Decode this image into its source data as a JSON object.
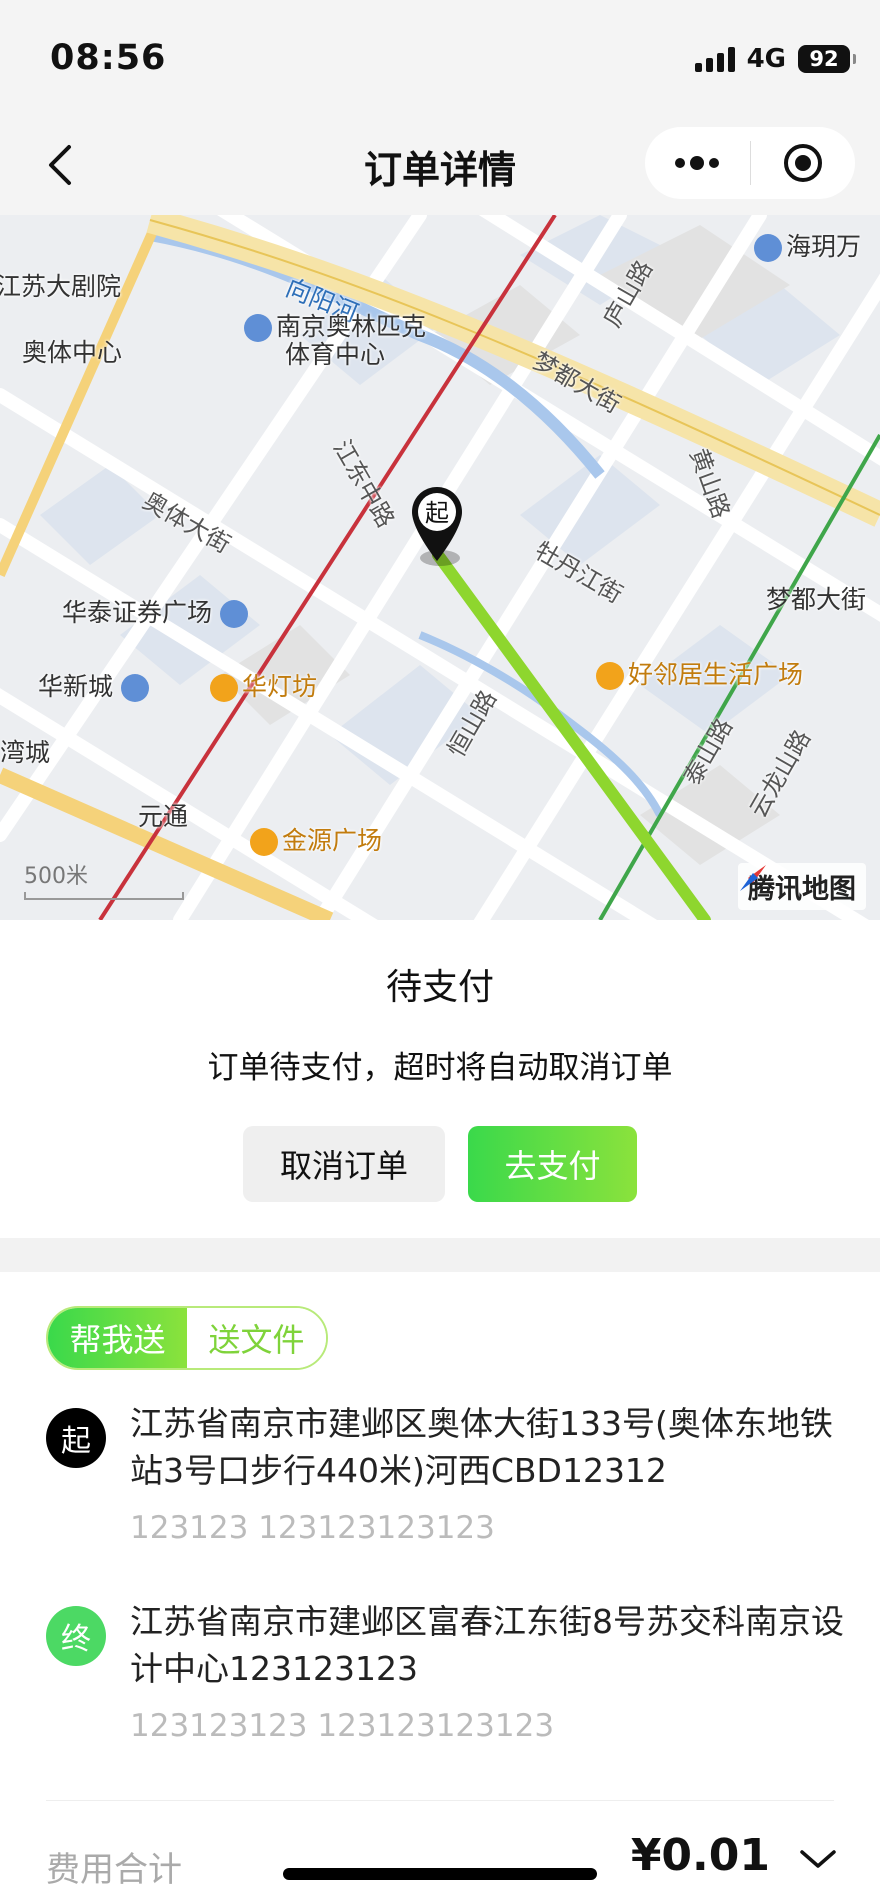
{
  "status_bar": {
    "time": "08:56",
    "network": "4G",
    "battery": "92"
  },
  "nav": {
    "title": "订单详情"
  },
  "map": {
    "labels": {
      "jiangsu_theater": "江苏大剧院",
      "xiangyang_river": "向阳河",
      "olympic_center": "奥体中心",
      "nanjing_olympic": "南京奥林匹克",
      "sports_center": "体育中心",
      "aoti_street": "奥体大街",
      "jiangdong_road": "江东中路",
      "mengdu_street": "梦都大街",
      "lushan_road": "庐山路",
      "huangshan_road": "黄山路",
      "mudanjiang_street": "牡丹江街",
      "huatai": "华泰证券广场",
      "huaxin_city": "华新城",
      "huadeng_fang": "华灯坊",
      "haolinju": "好邻居生活广场",
      "hengshan_road": "恒山路",
      "taishan_road": "泰山路",
      "yunlong_road": "云龙山路",
      "wan_cheng": "湾城",
      "yuantong": "元通",
      "jinyuan": "金源广场",
      "haiyue": "海玥万",
      "mengdu_right": "梦都大街",
      "scale": "500米",
      "logo": "腾讯地图",
      "pin": "起"
    }
  },
  "order_status": {
    "title": "待支付",
    "description": "订单待支付，超时将自动取消订单",
    "cancel_label": "取消订单",
    "pay_label": "去支付"
  },
  "route": {
    "tabs": [
      "帮我送",
      "送文件"
    ],
    "start": {
      "marker": "起",
      "address": "江苏省南京市建邺区奥体大街133号(奥体东地铁站3号口步行440米)河西CBD12312",
      "contact": "123123 123123123123"
    },
    "end": {
      "marker": "终",
      "address": "江苏省南京市建邺区富春江东街8号苏交科南京设计中心123123123",
      "contact": "123123123 123123123123"
    }
  },
  "fee": {
    "label": "费用合计",
    "value": "¥0.01"
  },
  "colors": {
    "accent_green": "#3ad94b",
    "accent_lime": "#8be23c",
    "route_line": "#8ed62e",
    "road_red": "#c8323c"
  }
}
